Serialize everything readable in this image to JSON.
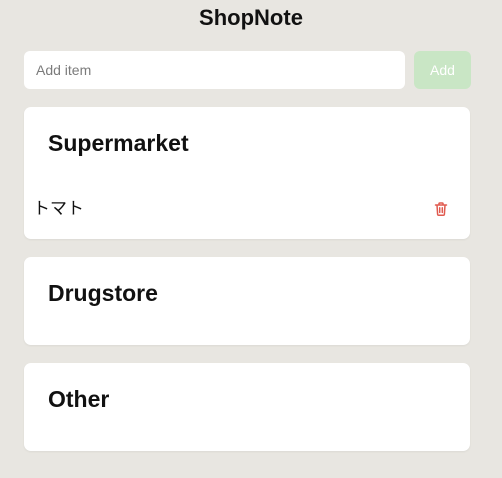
{
  "app": {
    "title": "ShopNote"
  },
  "add_form": {
    "placeholder": "Add item",
    "value": "",
    "add_label": "Add"
  },
  "colors": {
    "background": "#e8e6e1",
    "add_button_disabled": "#c9e6c5",
    "delete_icon": "#e05a4f"
  },
  "icons": {
    "delete": "trash-icon"
  },
  "sections": [
    {
      "name": "Supermarket",
      "items": [
        "トマト"
      ]
    },
    {
      "name": "Drugstore",
      "items": []
    },
    {
      "name": "Other",
      "items": []
    }
  ]
}
